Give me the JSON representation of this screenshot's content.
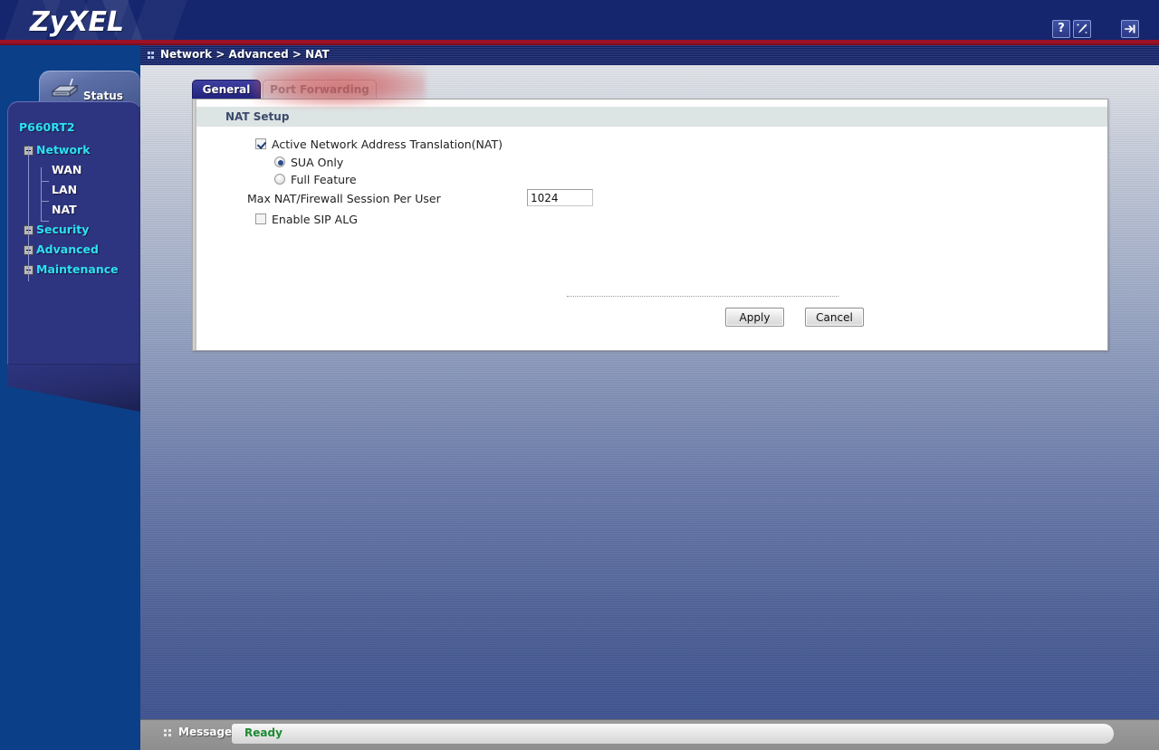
{
  "header": {
    "brand": "ZyXEL",
    "icons": [
      {
        "name": "help-icon",
        "glyph": "?"
      },
      {
        "name": "wizard-icon",
        "glyph": ""
      },
      {
        "name": "logout-icon",
        "glyph": ""
      }
    ]
  },
  "breadcrumb": {
    "text": "Network > Advanced > NAT"
  },
  "sidebar": {
    "status_tab_label": "Status",
    "device_name": "P660RT2",
    "items": [
      {
        "label": "Network",
        "level": 1,
        "state": "expanded",
        "selected": false
      },
      {
        "label": "WAN",
        "level": 2,
        "state": "leaf",
        "selected": false
      },
      {
        "label": "LAN",
        "level": 2,
        "state": "leaf",
        "selected": false
      },
      {
        "label": "NAT",
        "level": 2,
        "state": "leaf",
        "selected": true
      },
      {
        "label": "Security",
        "level": 1,
        "state": "collapsed",
        "selected": false
      },
      {
        "label": "Advanced",
        "level": 1,
        "state": "collapsed",
        "selected": false
      },
      {
        "label": "Maintenance",
        "level": 1,
        "state": "collapsed",
        "selected": false
      }
    ]
  },
  "tabs": [
    {
      "label": "General",
      "active": true
    },
    {
      "label": "Port Forwarding",
      "active": false
    }
  ],
  "panel": {
    "section_title": "NAT Setup",
    "active_nat_label": "Active Network Address Translation(NAT)",
    "active_nat_checked": true,
    "nat_mode_options": [
      {
        "label": "SUA Only",
        "selected": true
      },
      {
        "label": "Full Feature",
        "selected": false
      }
    ],
    "max_sessions_label": "Max NAT/Firewall Session Per User",
    "max_sessions_value": "1024",
    "sip_alg_label": "Enable SIP ALG",
    "sip_alg_checked": false,
    "apply_label": "Apply",
    "cancel_label": "Cancel"
  },
  "status_bar": {
    "label": "Message",
    "status": "Ready",
    "status_color": "#1d8a31"
  },
  "colors": {
    "header_blue": "#15256e",
    "accent_red": "#9d1126",
    "sidebar_blue": "#0b3f88",
    "nav_panel": "#2e3580",
    "nav_link_cyan": "#2de0f5",
    "section_header": "#dde4e4",
    "tab_active": "#22237d",
    "highlight_blob": "#c82828"
  }
}
